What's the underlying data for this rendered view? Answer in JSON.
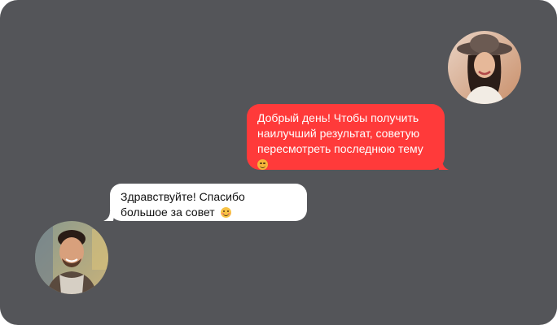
{
  "conversation": {
    "messages": [
      {
        "sender": "woman",
        "lines": [
          "Добрый день! Чтобы получить",
          "наилучший результат, советую",
          "пересмотреть последнюю тему"
        ],
        "emoji": "winking-face-icon"
      },
      {
        "sender": "man",
        "lines": [
          "Здравствуйте! Спасибо",
          "большое за совет"
        ],
        "emoji": "smiling-face-icon"
      }
    ]
  },
  "colors": {
    "background": "#545559",
    "outgoing_bubble": "#ff3a3a",
    "incoming_bubble": "#ffffff"
  }
}
